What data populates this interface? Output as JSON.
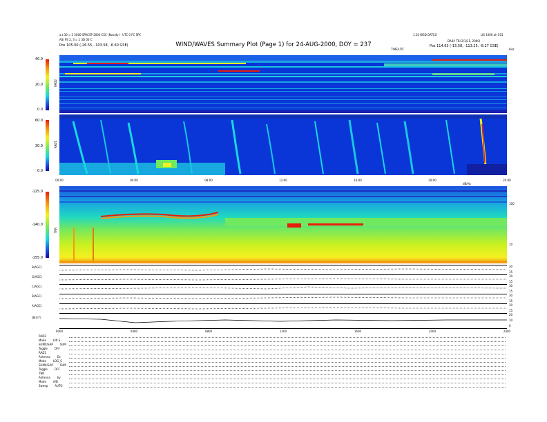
{
  "header": {
    "title": "WIND/WAVES Summary Plot (Page 1) for 24-AUG-2000, DOY = 237",
    "left_line1": "a.t.30 = 3 2000 SPACSP 2000 CSC (Nov/dy) - UTC 0 FC SPC",
    "left_line2": "AS/ PS 2, 3 = 1 3D 00 C",
    "left_pos": "Pos   105.00 (-26.55, -103.58, -6.60 GSE)",
    "right_top1": "1.10 WSD DATCO",
    "right_top2": "LIS 1000 ah 501",
    "right_line": "DAILY  TRI 2/1(11, 2000)",
    "right_pos": "Pos   114.63 (-15.58, -113.25, -8.27 GSE)",
    "label_center": "TIME/UTC",
    "label_corner": "kHz"
  },
  "panels": {
    "rad2": {
      "label": "RAD2",
      "ticks": [
        "40.0",
        "20.0",
        "0.0"
      ]
    },
    "rad1": {
      "label": "RAD1",
      "ticks": [
        "60.0",
        "30.0",
        "0.0"
      ]
    },
    "tnr": {
      "label": "TNR",
      "ticks": [
        "-125.0",
        "-140.0",
        "-155.0"
      ],
      "right_ticks": [
        "100",
        "10"
      ],
      "right_unit": "dB/Hz"
    },
    "time_axis_1": [
      "00:00",
      "04:00",
      "08:00",
      "12:00",
      "16:00",
      "20:00",
      "24:00"
    ],
    "line_panels": [
      {
        "label": "B(AGC)",
        "right": [
          "30",
          "15"
        ]
      },
      {
        "label": "G(AGC)",
        "right": [
          "30",
          "15"
        ]
      },
      {
        "label": "C(AGC)",
        "right": [
          "30",
          "15"
        ]
      },
      {
        "label": "B(AGC)",
        "right": [
          "30",
          "15"
        ]
      },
      {
        "label": "A(AGC)",
        "right": [
          "30",
          "15"
        ]
      },
      {
        "label": "|B|(nT)",
        "right": [
          "20",
          "10",
          "0"
        ]
      }
    ],
    "time_axis_2": [
      "0000",
      "0400",
      "0800",
      "1200",
      "1600",
      "2000",
      "2400"
    ]
  },
  "footer": [
    {
      "k": "RAD2",
      "v": ""
    },
    {
      "k": "Mode",
      "v": "LIN S"
    },
    {
      "k": "SUMX/SAP",
      "v": "SUM"
    },
    {
      "k": "Toggle",
      "v": "OFF"
    },
    {
      "k": "RAD1",
      "v": ""
    },
    {
      "k": "Antenna",
      "v": "Ex"
    },
    {
      "k": "Mode",
      "v": "LOG_S"
    },
    {
      "k": "SUMX/SAP",
      "v": "SUM"
    },
    {
      "k": "Toggle",
      "v": "OFF"
    },
    {
      "k": "TNR",
      "v": ""
    },
    {
      "k": "Antenna",
      "v": "Ey"
    },
    {
      "k": "Mode",
      "v": "A/B"
    },
    {
      "k": "Sweep",
      "v": "AUTO"
    }
  ],
  "colors": {
    "background": "#0a36d8",
    "cbar_top": "#e81c0c",
    "cbar_mid": "#f5f020",
    "cbar_low": "#18d8e0",
    "cbar_bottom": "#1a0aa0"
  },
  "chart_data": {
    "type": "heatmap",
    "title": "WIND/WAVES Summary Plot (Page 1) for 24-AUG-2000, DOY = 237",
    "x_range_hours": [
      0,
      24
    ],
    "panels": [
      {
        "name": "RAD2",
        "y_range": [
          0,
          40
        ],
        "colorscale": "jet"
      },
      {
        "name": "RAD1",
        "y_range": [
          0,
          60
        ],
        "colorscale": "jet"
      },
      {
        "name": "TNR",
        "y_range": [
          -155,
          -125
        ],
        "colorscale": "jet"
      }
    ],
    "line_panels": [
      "B(AGC)",
      "G(AGC)",
      "C(AGC)",
      "B(AGC)",
      "A(AGC)",
      "|B|(nT)"
    ]
  }
}
